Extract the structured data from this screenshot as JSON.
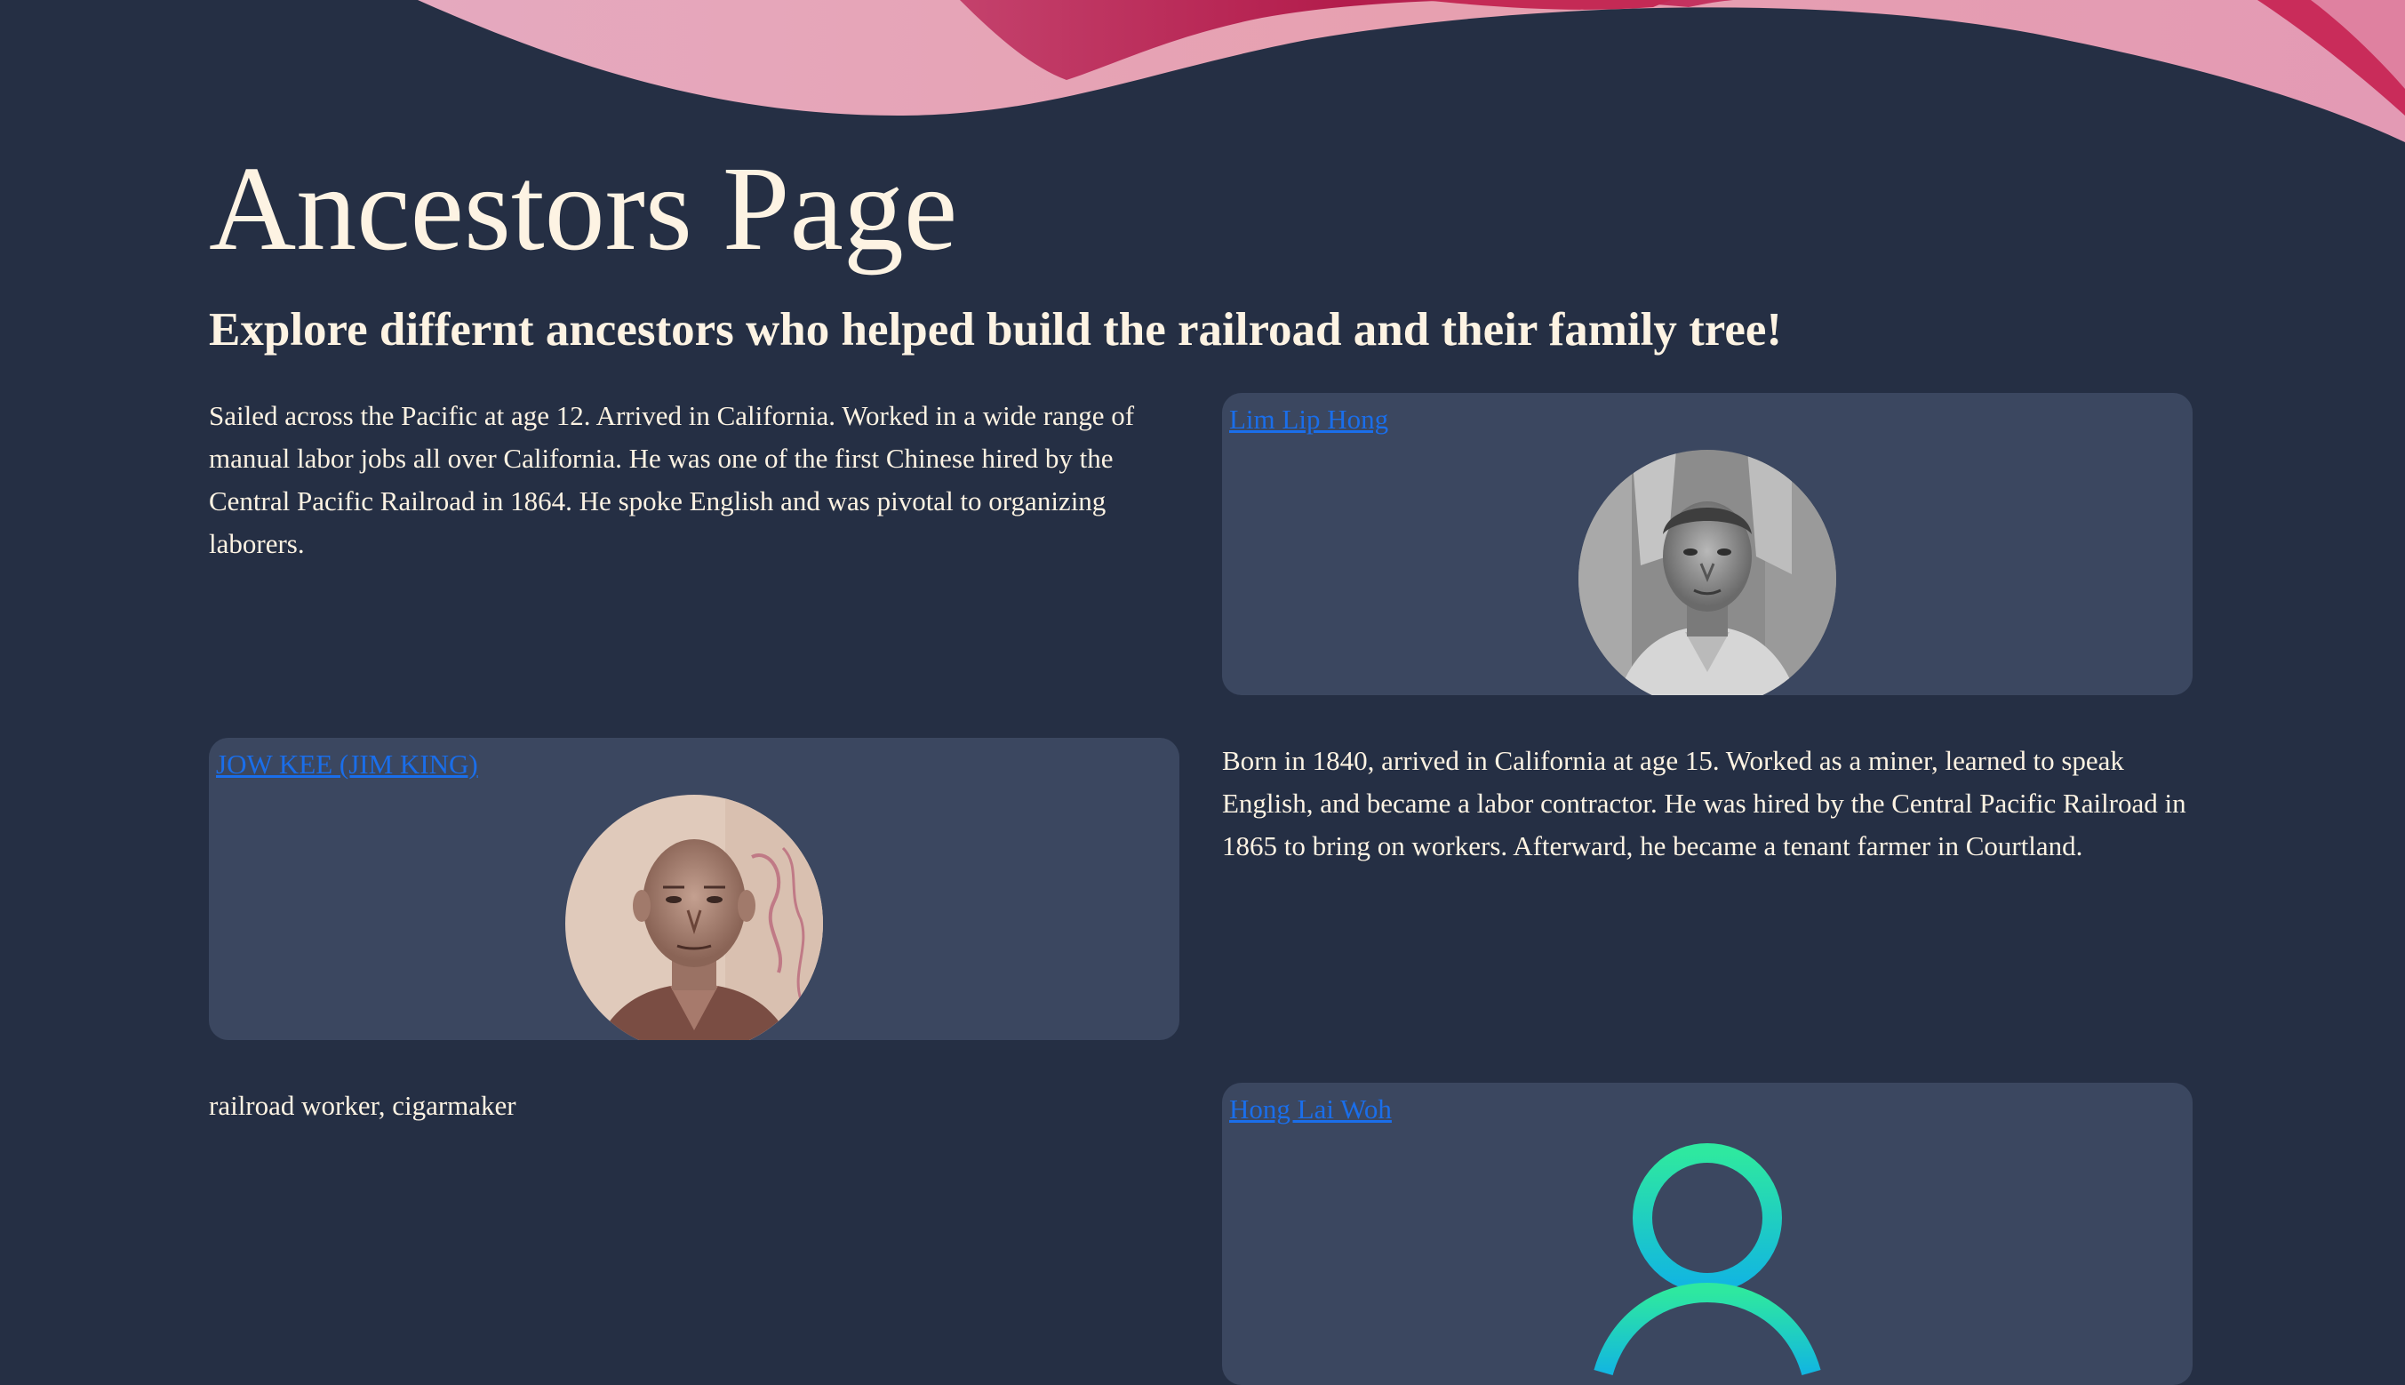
{
  "header": {
    "title": "Ancestors Page",
    "subtitle": "Explore differnt ancestors who helped build the railroad and their family tree!"
  },
  "ancestors": [
    {
      "name": "Lim Lip Hong",
      "bio": "Sailed across the Pacific at age 12. Arrived in California. Worked in a wide range of manual labor jobs all over California. He was one of the first Chinese hired by the Central Pacific Railroad in 1864. He spoke English and was pivotal to organizing laborers.",
      "photo": "grayscale-portrait"
    },
    {
      "name": "JOW KEE (JIM KING)",
      "bio": "Born in 1840, arrived in California at age 15. Worked as a miner, learned to speak English, and became a labor contractor. He was hired by the Central Pacific Railroad in 1865 to bring on workers. Afterward, he became a tenant farmer in Courtland.",
      "photo": "sepia-portrait"
    },
    {
      "name": "Hong Lai Woh",
      "bio": "railroad worker, cigarmaker",
      "photo": "user-placeholder-icon"
    }
  ],
  "colors": {
    "background": "#252f44",
    "card": "#3b4760",
    "text": "#fdf3e3",
    "link": "#1a6eea",
    "wave_pink": "#e6a4b8",
    "wave_crimson": "#b21f4a",
    "icon_gradient_top": "#2ee8a0",
    "icon_gradient_bottom": "#12b6e0"
  }
}
